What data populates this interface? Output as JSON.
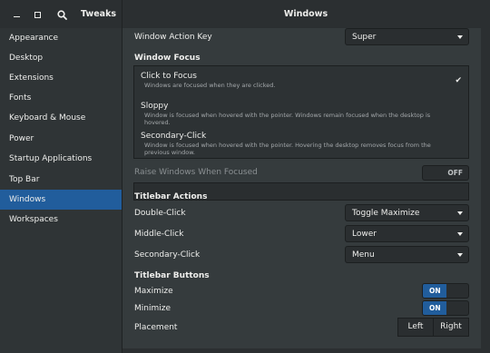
{
  "header": {
    "app_title": "Tweaks",
    "window_title": "Windows",
    "icons": [
      "minimize-icon",
      "maximize-icon",
      "search-icon"
    ]
  },
  "sidebar": {
    "items": [
      {
        "label": "Appearance"
      },
      {
        "label": "Desktop"
      },
      {
        "label": "Extensions"
      },
      {
        "label": "Fonts"
      },
      {
        "label": "Keyboard & Mouse"
      },
      {
        "label": "Power"
      },
      {
        "label": "Startup Applications"
      },
      {
        "label": "Top Bar"
      },
      {
        "label": "Windows",
        "selected": true
      },
      {
        "label": "Workspaces"
      }
    ]
  },
  "content": {
    "window_action_key": {
      "label": "Window Action Key",
      "value": "Super"
    },
    "window_focus": {
      "heading": "Window Focus",
      "options": [
        {
          "title": "Click to Focus",
          "desc": "Windows are focused when they are clicked.",
          "selected": true
        },
        {
          "title": "Sloppy",
          "desc": "Window is focused when hovered with the pointer. Windows remain focused when the desktop is hovered."
        },
        {
          "title": "Secondary-Click",
          "desc": "Window is focused when hovered with the pointer. Hovering the desktop removes focus from the previous window."
        }
      ],
      "check_mark": "✔"
    },
    "raise_windows": {
      "label": "Raise Windows When Focused",
      "state": "OFF"
    },
    "titlebar_actions": {
      "heading": "Titlebar Actions",
      "double_click": {
        "label": "Double-Click",
        "value": "Toggle Maximize"
      },
      "middle_click": {
        "label": "Middle-Click",
        "value": "Lower"
      },
      "secondary_click": {
        "label": "Secondary-Click",
        "value": "Menu"
      }
    },
    "titlebar_buttons": {
      "heading": "Titlebar Buttons",
      "maximize": {
        "label": "Maximize",
        "state": "ON"
      },
      "minimize": {
        "label": "Minimize",
        "state": "ON"
      },
      "placement": {
        "label": "Placement",
        "left": "Left",
        "right": "Right",
        "selected": "Right"
      }
    }
  },
  "colors": {
    "accent": "#215d9c",
    "background": "#353b3d",
    "sidebar": "#2f3436"
  }
}
